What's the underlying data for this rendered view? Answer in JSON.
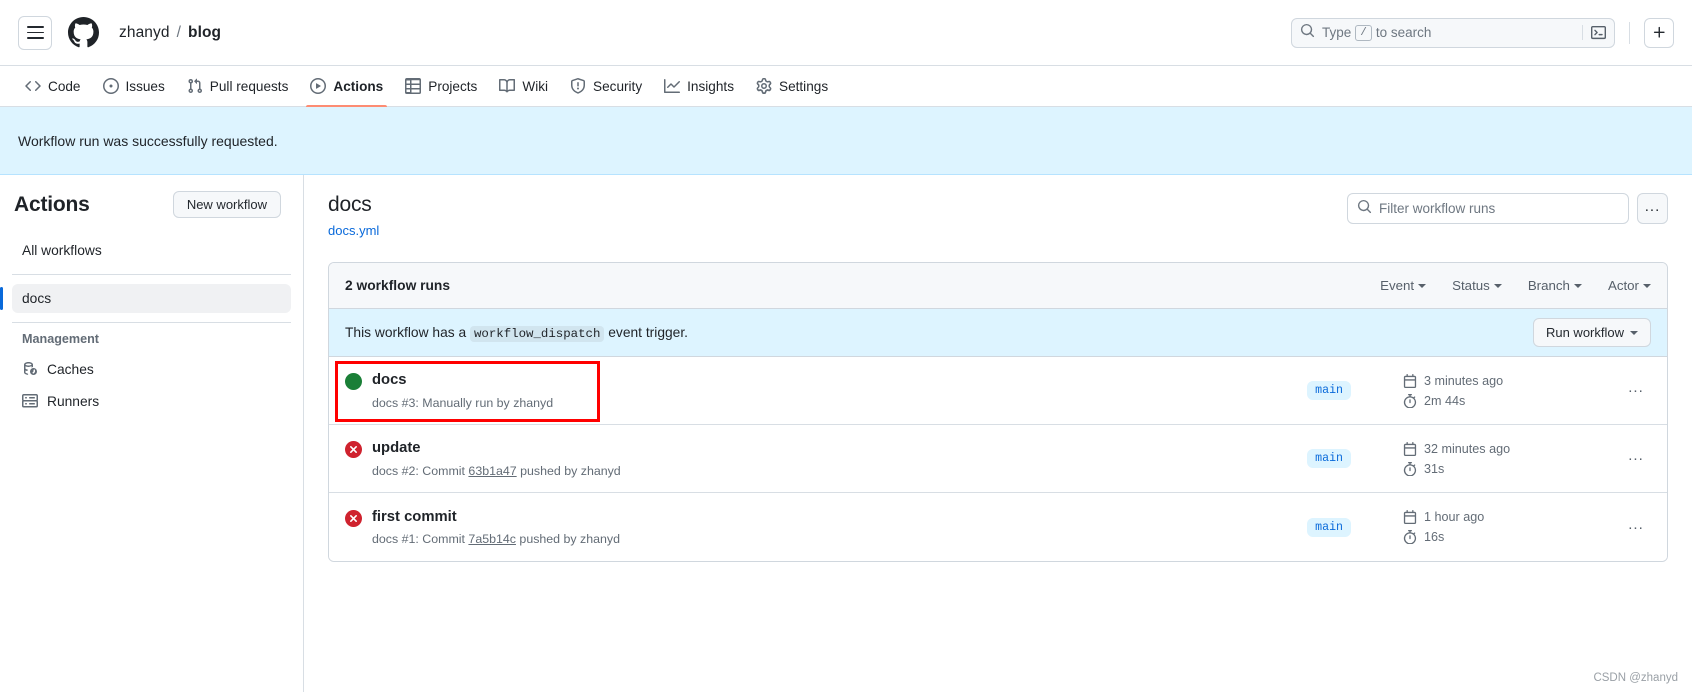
{
  "header": {
    "menu_icon": "hamburger-icon",
    "logo_icon": "github-logo-icon",
    "breadcrumb": {
      "owner": "zhanyd",
      "separator": "/",
      "repo": "blog"
    },
    "search": {
      "icon": "search-icon",
      "placeholder_prefix": "Type",
      "placeholder_kbd": "/",
      "placeholder_suffix": "to search",
      "command_icon": "terminal-icon"
    },
    "create_new_label": "+",
    "create_new_icon": "plus-icon"
  },
  "nav": {
    "tabs": [
      {
        "label": "Code",
        "icon": "code-icon",
        "active": false
      },
      {
        "label": "Issues",
        "icon": "issue-opened-icon",
        "active": false
      },
      {
        "label": "Pull requests",
        "icon": "git-pull-request-icon",
        "active": false
      },
      {
        "label": "Actions",
        "icon": "play-icon",
        "active": true
      },
      {
        "label": "Projects",
        "icon": "table-icon",
        "active": false
      },
      {
        "label": "Wiki",
        "icon": "book-icon",
        "active": false
      },
      {
        "label": "Security",
        "icon": "shield-icon",
        "active": false
      },
      {
        "label": "Insights",
        "icon": "graph-icon",
        "active": false
      },
      {
        "label": "Settings",
        "icon": "gear-icon",
        "active": false
      }
    ],
    "active_underline_color": "#fd8c73"
  },
  "flash": {
    "message": "Workflow run was successfully requested.",
    "background": "#ddf4ff"
  },
  "sidebar": {
    "title": "Actions",
    "new_workflow_label": "New workflow",
    "all_workflows_label": "All workflows",
    "workflows": [
      {
        "label": "docs",
        "selected": true
      }
    ],
    "group_title": "Management",
    "management": [
      {
        "label": "Caches",
        "icon": "cache-icon"
      },
      {
        "label": "Runners",
        "icon": "server-icon"
      }
    ],
    "selected_indicator_color": "#0969da"
  },
  "main": {
    "workflow_title": "docs",
    "workflow_file": "docs.yml",
    "filter": {
      "icon": "search-icon",
      "placeholder": "Filter workflow runs"
    },
    "more_options_label": "...",
    "runs_count_label": "2 workflow runs",
    "filters": [
      {
        "label": "Event"
      },
      {
        "label": "Status"
      },
      {
        "label": "Branch"
      },
      {
        "label": "Actor"
      }
    ],
    "dispatch": {
      "text_before": "This workflow has a",
      "code": "workflow_dispatch",
      "text_after": "event trigger.",
      "run_button_label": "Run workflow"
    },
    "runs": [
      {
        "status": "success",
        "status_icon": "check-circle-fill-icon",
        "name": "docs",
        "subtitle": "docs #3: Manually run by zhanyd",
        "subtitle_prefix": "docs #3: Manually run by zhanyd",
        "commit_link": "",
        "subtitle_suffix": "",
        "branch": "main",
        "time_icon": "calendar-icon",
        "time": "3 minutes ago",
        "duration_icon": "stopwatch-icon",
        "duration": "2m 44s",
        "menu_label": "...",
        "highlighted": true
      },
      {
        "status": "failure",
        "status_icon": "x-circle-fill-icon",
        "name": "update",
        "subtitle": "docs #2: Commit 63b1a47 pushed by zhanyd",
        "subtitle_prefix": "docs #2: Commit",
        "commit_link": "63b1a47",
        "subtitle_suffix": "pushed by zhanyd",
        "branch": "main",
        "time_icon": "calendar-icon",
        "time": "32 minutes ago",
        "duration_icon": "stopwatch-icon",
        "duration": "31s",
        "menu_label": "...",
        "highlighted": false
      },
      {
        "status": "failure",
        "status_icon": "x-circle-fill-icon",
        "name": "first commit",
        "subtitle": "docs #1: Commit 7a5b14c pushed by zhanyd",
        "subtitle_prefix": "docs #1: Commit",
        "commit_link": "7a5b14c",
        "subtitle_suffix": "pushed by zhanyd",
        "branch": "main",
        "time_icon": "calendar-icon",
        "time": "1 hour ago",
        "duration_icon": "stopwatch-icon",
        "duration": "16s",
        "menu_label": "...",
        "highlighted": false
      }
    ],
    "highlight_color": "#ff0000"
  },
  "watermark": "CSDN @zhanyd"
}
